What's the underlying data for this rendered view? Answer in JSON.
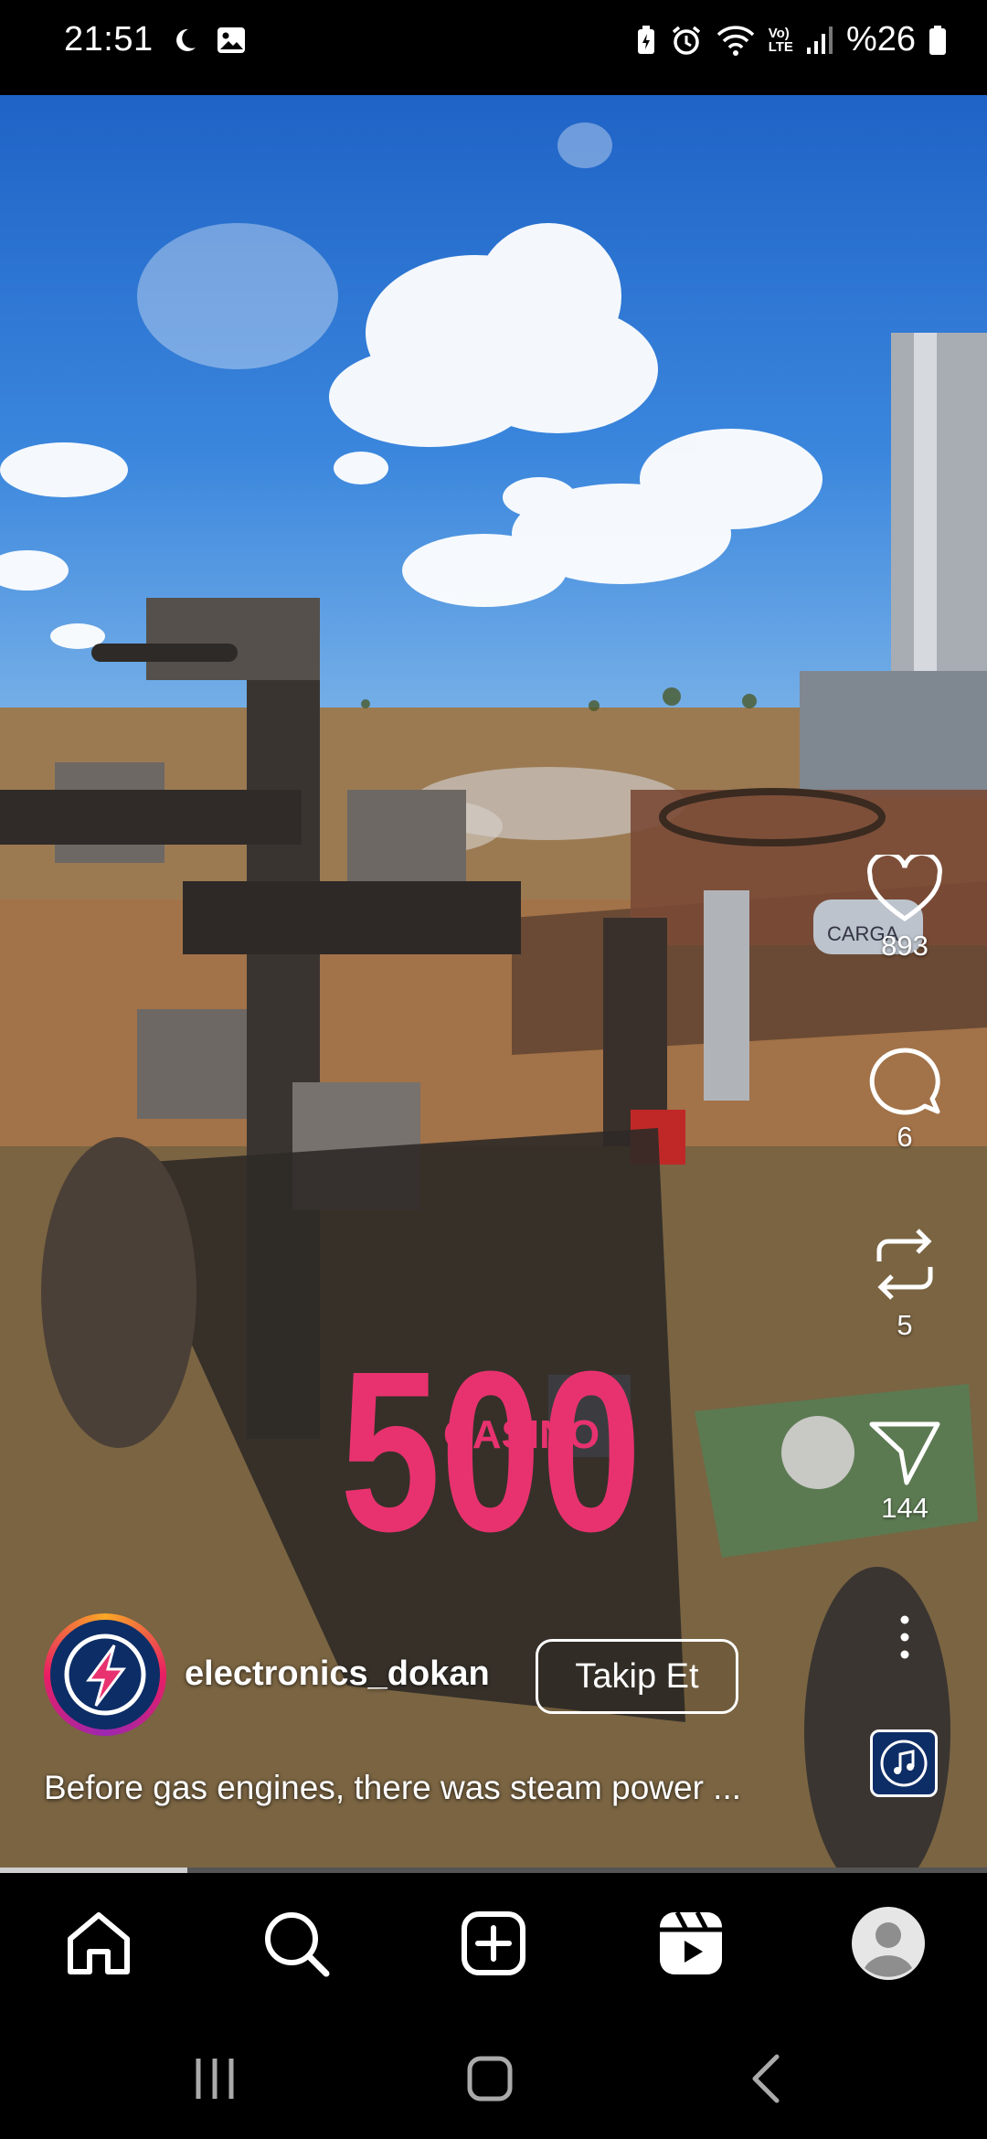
{
  "status_bar": {
    "time": "21:51",
    "battery_percent": "%26",
    "left_icons": [
      "moon-icon",
      "gallery-icon"
    ],
    "right_icons": [
      "battery-saver-icon",
      "alarm-icon",
      "wifi-icon",
      "volte-icon",
      "signal-icon",
      "battery-icon"
    ],
    "volte_label_top": "Vo)",
    "volte_label_bottom": "LTE"
  },
  "video": {
    "overlay_text_large": "500",
    "overlay_text_small": "CASINO",
    "progress": 0.19,
    "scene_text": "CARGA"
  },
  "actions": {
    "like_count": "893",
    "comment_count": "6",
    "repost_count": "5",
    "share_count": "144"
  },
  "account": {
    "username": "electronics_dokan",
    "follow_label": "Takip Et"
  },
  "caption": "Before gas engines, there was steam power ...",
  "bottom_nav": [
    "home-icon",
    "search-icon",
    "create-icon",
    "reels-icon",
    "profile-icon"
  ],
  "colors": {
    "overlay_pink": "#e8326f",
    "avatar_bg": "#0d2d66",
    "background": "#000000"
  }
}
